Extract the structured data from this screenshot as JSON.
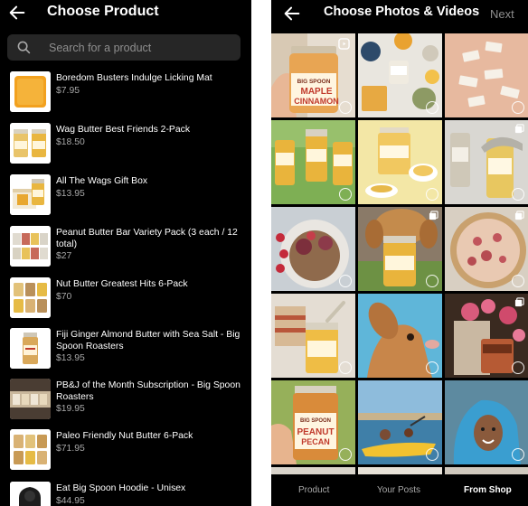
{
  "left": {
    "title": "Choose Product",
    "search_placeholder": "Search for a product",
    "products": [
      {
        "name": "Boredom Busters Indulge Licking Mat",
        "price": "$7.95"
      },
      {
        "name": "Wag Butter Best Friends 2-Pack",
        "price": "$18.50"
      },
      {
        "name": "All The Wags Gift Box",
        "price": "$13.95"
      },
      {
        "name": "Peanut Butter Bar Variety Pack (3 each / 12 total)",
        "price": "$27"
      },
      {
        "name": "Nut Butter Greatest Hits 6-Pack",
        "price": "$70"
      },
      {
        "name": "Fiji Ginger Almond Butter with Sea Salt - Big Spoon Roasters",
        "price": "$13.95"
      },
      {
        "name": "PB&J of the Month Subscription - Big Spoon Roasters",
        "price": "$19.95"
      },
      {
        "name": "Paleo Friendly Nut Butter 6-Pack",
        "price": "$71.95"
      },
      {
        "name": "Eat Big Spoon Hoodie - Unisex",
        "price": "$44.95"
      }
    ]
  },
  "right": {
    "title": "Choose Photos & Videos",
    "next_label": "Next",
    "jar_labels": {
      "maple_brand": "BIG SPOON",
      "maple_flavor_1": "MAPLE",
      "maple_flavor_2": "CINNAMON",
      "peanut_brand": "BIG SPOON",
      "peanut_flavor_1": "PEANUT",
      "peanut_flavor_2": "PECAN"
    },
    "tabs": [
      "Product",
      "Your Posts",
      "From Shop"
    ],
    "active_tab": "From Shop"
  }
}
